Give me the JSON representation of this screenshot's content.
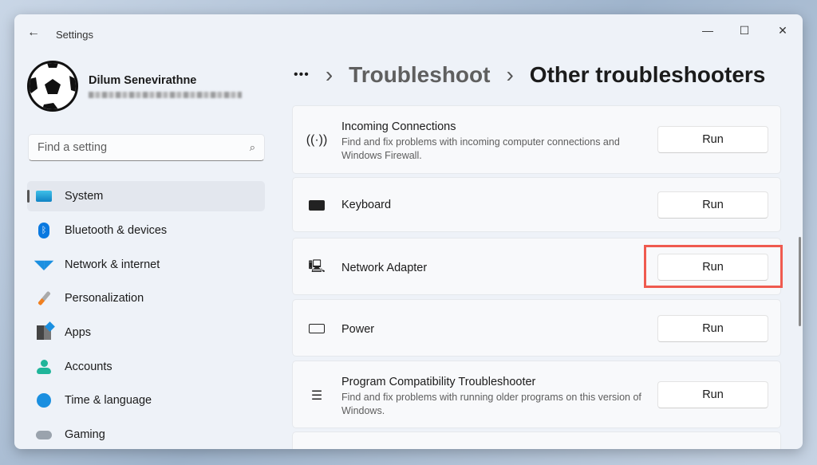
{
  "window": {
    "title": "Settings",
    "minimize": "—",
    "maximize": "☐",
    "close": "✕"
  },
  "user": {
    "name": "Dilum Senevirathne"
  },
  "search": {
    "placeholder": "Find a setting"
  },
  "sidebar": {
    "items": [
      {
        "label": "System",
        "selected": true
      },
      {
        "label": "Bluetooth & devices"
      },
      {
        "label": "Network & internet"
      },
      {
        "label": "Personalization"
      },
      {
        "label": "Apps"
      },
      {
        "label": "Accounts"
      },
      {
        "label": "Time & language"
      },
      {
        "label": "Gaming"
      }
    ]
  },
  "breadcrumb": {
    "more": "•••",
    "sep": "›",
    "parent": "Troubleshoot",
    "current": "Other troubleshooters"
  },
  "troubleshooters": [
    {
      "title": "Incoming Connections",
      "description": "Find and fix problems with incoming computer connections and Windows Firewall.",
      "button": "Run",
      "icon": "antenna-icon"
    },
    {
      "title": "Keyboard",
      "button": "Run",
      "icon": "keyboard-icon"
    },
    {
      "title": "Network Adapter",
      "button": "Run",
      "icon": "network-adapter-icon",
      "highlighted": true
    },
    {
      "title": "Power",
      "button": "Run",
      "icon": "battery-icon"
    },
    {
      "title": "Program Compatibility Troubleshooter",
      "description": "Find and fix problems with running older programs on this version of Windows.",
      "button": "Run",
      "icon": "list-icon"
    }
  ],
  "colors": {
    "highlight": "#ef5a4f",
    "accent": "#0067c0"
  }
}
